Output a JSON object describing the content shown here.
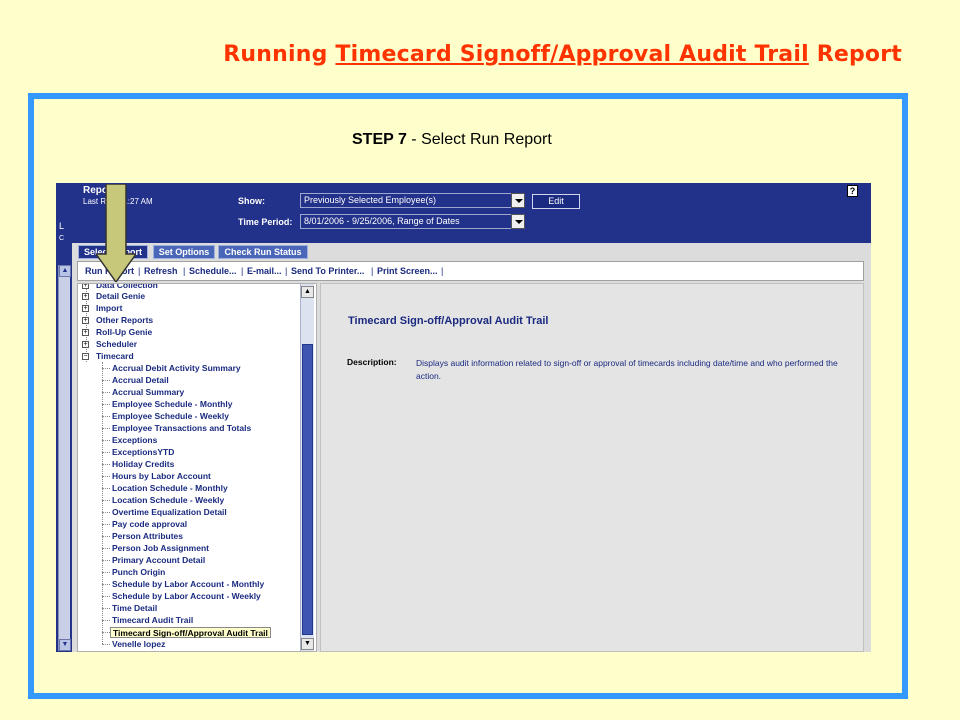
{
  "slide": {
    "title_prefix": "Running ",
    "title_link": "Timecard Signoff/Approval Audit Trail",
    "title_suffix": " Report",
    "step_label": "STEP 7",
    "step_text": " - Select Run Report"
  },
  "header": {
    "report_title": "Repo",
    "last_run": "Last R        ed:11:27 AM",
    "show_label": "Show:",
    "show_value": "Previously Selected Employee(s)",
    "time_period_label": "Time Period:",
    "time_period_value": "8/01/2006 - 9/25/2006, Range of Dates",
    "edit_label": "Edit",
    "help_label": "?",
    "side_letter_1": "L",
    "side_letter_2": "C"
  },
  "tabs": [
    {
      "label": "Select Report"
    },
    {
      "label": "Set Options"
    },
    {
      "label": "Check Run Status"
    }
  ],
  "toolbar": {
    "items": [
      "Run Report",
      "Refresh",
      "Schedule...",
      "E-mail...",
      "Send To Printer...",
      "Print Screen..."
    ],
    "separator": "|"
  },
  "tree": {
    "top_items": [
      "Data Collection",
      "Detail Genie",
      "Import",
      "Other Reports",
      "Roll-Up Genie",
      "Scheduler"
    ],
    "open_item": "Timecard",
    "expanded_symbol": "−",
    "collapsed_symbol": "+",
    "children": [
      "Accrual Debit Activity Summary",
      "Accrual Detail",
      "Accrual Summary",
      "Employee Schedule - Monthly",
      "Employee Schedule - Weekly",
      "Employee Transactions and Totals",
      "Exceptions",
      "ExceptionsYTD",
      "Holiday Credits",
      "Hours by Labor Account",
      "Location Schedule - Monthly",
      "Location Schedule - Weekly",
      "Overtime Equalization Detail",
      "Pay code approval",
      "Person Attributes",
      "Person Job Assignment",
      "Primary Account Detail",
      "Punch Origin",
      "Schedule by Labor Account - Monthly",
      "Schedule by Labor Account - Weekly",
      "Time Detail",
      "Timecard Audit Trail",
      "Timecard Sign-off/Approval Audit Trail",
      "Venelle lopez"
    ],
    "selected": "Timecard Sign-off/Approval Audit Trail"
  },
  "content": {
    "title": "Timecard Sign-off/Approval Audit Trail",
    "description_label": "Description:",
    "description": "Displays audit information related to sign-off or approval of timecards including date/time and who performed the action."
  },
  "colors": {
    "slide_bg": "#ffffcc",
    "title_color": "#ff3300",
    "frame_border": "#3399ff",
    "header_bg": "#22318a",
    "arrow_fill": "#c8c87a"
  },
  "icons": {
    "arrow": "down-arrow-pointer-icon",
    "help": "help-icon",
    "dropdown": "chevron-down-icon",
    "tree_toggle": "tree-expand-icon"
  }
}
